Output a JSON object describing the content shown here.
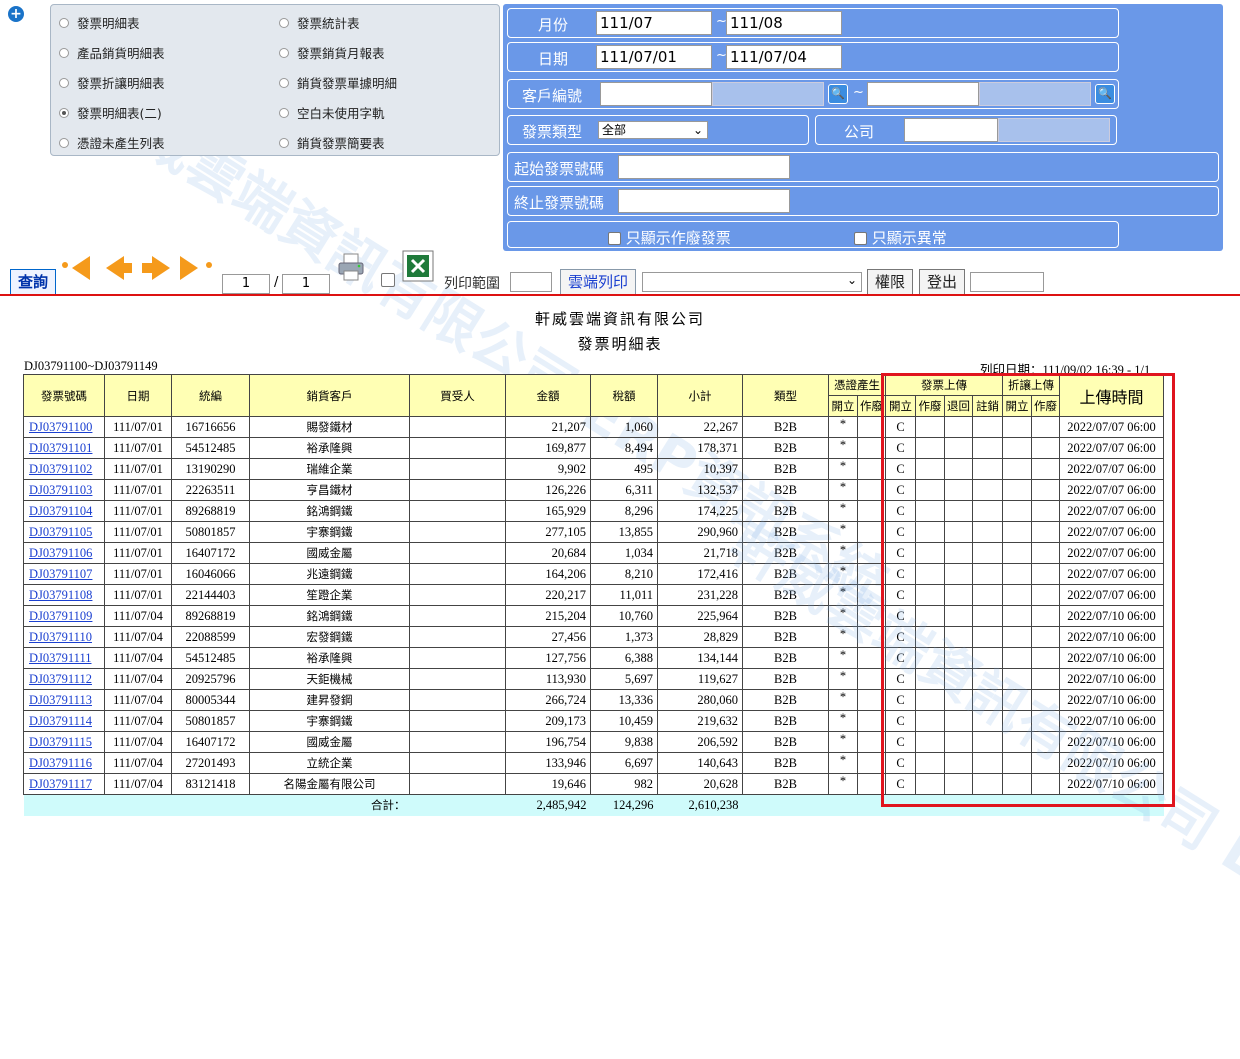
{
  "reports": {
    "left": [
      "發票明細表",
      "產品銷貨明細表",
      "發票折讓明細表",
      "發票明細表(二)",
      "憑證未產生列表"
    ],
    "right": [
      "發票統計表",
      "發票銷貨月報表",
      "銷貨發票單據明細",
      "空白未使用字軌",
      "銷貨發票簡要表"
    ],
    "selected": "發票明細表(二)"
  },
  "filters": {
    "month_label": "月份",
    "month_from": "111/07",
    "month_to": "111/08",
    "date_label": "日期",
    "date_from": "111/07/01",
    "date_to": "111/07/04",
    "customer_label": "客戶編號",
    "invoice_type_label": "發票類型",
    "invoice_type_value": "全部",
    "company_label": "公司",
    "start_no_label": "起始發票號碼",
    "end_no_label": "終止發票號碼",
    "only_void_label": "只顯示作廢發票",
    "only_abnormal_label": "只顯示異常",
    "tilde": "~"
  },
  "toolbar": {
    "query": "查詢",
    "page_current": "1",
    "page_sep": "/",
    "page_total": "1",
    "print_range": "列印範圍",
    "cloud_print": "雲端列印",
    "permission": "權限",
    "logout": "登出"
  },
  "report": {
    "company": "軒威雲端資訊有限公司",
    "name": "發票明細表",
    "range": "DJ03791100~DJ03791149",
    "print_date": "列印日期：111/09/02  16:39 - 1/1"
  },
  "watermark": "軒威雲端資訊有限公司 ERP資訊系統",
  "headers": {
    "no": "發票號碼",
    "date": "日期",
    "tax_id": "統編",
    "customer": "銷貨客戶",
    "buyer": "買受人",
    "amount": "金額",
    "tax": "稅額",
    "subtotal": "小計",
    "type": "類型",
    "voucher": "憑證產生",
    "upload": "發票上傳",
    "allowance": "折讓上傳",
    "upload_time": "上傳時間",
    "open": "開立",
    "void": "作廢",
    "return": "退回",
    "cancel": "註銷"
  },
  "rows": [
    {
      "no": "DJ03791100",
      "date": "111/07/01",
      "tax_id": "16716656",
      "customer": "賜發鐵材",
      "amount": "21,207",
      "tax": "1,060",
      "subtotal": "22,267",
      "type": "B2B",
      "v": "*",
      "u": "C",
      "time": "2022/07/07 06:00"
    },
    {
      "no": "DJ03791101",
      "date": "111/07/01",
      "tax_id": "54512485",
      "customer": "裕承隆興",
      "amount": "169,877",
      "tax": "8,494",
      "subtotal": "178,371",
      "type": "B2B",
      "v": "*",
      "u": "C",
      "time": "2022/07/07 06:00"
    },
    {
      "no": "DJ03791102",
      "date": "111/07/01",
      "tax_id": "13190290",
      "customer": "瑞維企業",
      "amount": "9,902",
      "tax": "495",
      "subtotal": "10,397",
      "type": "B2B",
      "v": "*",
      "u": "C",
      "time": "2022/07/07 06:00"
    },
    {
      "no": "DJ03791103",
      "date": "111/07/01",
      "tax_id": "22263511",
      "customer": "亨昌鐵材",
      "amount": "126,226",
      "tax": "6,311",
      "subtotal": "132,537",
      "type": "B2B",
      "v": "*",
      "u": "C",
      "time": "2022/07/07 06:00"
    },
    {
      "no": "DJ03791104",
      "date": "111/07/01",
      "tax_id": "89268819",
      "customer": "銘鴻鋼鐵",
      "amount": "165,929",
      "tax": "8,296",
      "subtotal": "174,225",
      "type": "B2B",
      "v": "*",
      "u": "C",
      "time": "2022/07/07 06:00"
    },
    {
      "no": "DJ03791105",
      "date": "111/07/01",
      "tax_id": "50801857",
      "customer": "宇寨鋼鐵",
      "amount": "277,105",
      "tax": "13,855",
      "subtotal": "290,960",
      "type": "B2B",
      "v": "*",
      "u": "C",
      "time": "2022/07/07 06:00"
    },
    {
      "no": "DJ03791106",
      "date": "111/07/01",
      "tax_id": "16407172",
      "customer": "國威金屬",
      "amount": "20,684",
      "tax": "1,034",
      "subtotal": "21,718",
      "type": "B2B",
      "v": "*",
      "u": "C",
      "time": "2022/07/07 06:00"
    },
    {
      "no": "DJ03791107",
      "date": "111/07/01",
      "tax_id": "16046066",
      "customer": "兆遠鋼鐵",
      "amount": "164,206",
      "tax": "8,210",
      "subtotal": "172,416",
      "type": "B2B",
      "v": "*",
      "u": "C",
      "time": "2022/07/07 06:00"
    },
    {
      "no": "DJ03791108",
      "date": "111/07/01",
      "tax_id": "22144403",
      "customer": "笙蹬企業",
      "amount": "220,217",
      "tax": "11,011",
      "subtotal": "231,228",
      "type": "B2B",
      "v": "*",
      "u": "C",
      "time": "2022/07/07 06:00"
    },
    {
      "no": "DJ03791109",
      "date": "111/07/04",
      "tax_id": "89268819",
      "customer": "銘鴻鋼鐵",
      "amount": "215,204",
      "tax": "10,760",
      "subtotal": "225,964",
      "type": "B2B",
      "v": "*",
      "u": "C",
      "time": "2022/07/10 06:00"
    },
    {
      "no": "DJ03791110",
      "date": "111/07/04",
      "tax_id": "22088599",
      "customer": "宏發鋼鐵",
      "amount": "27,456",
      "tax": "1,373",
      "subtotal": "28,829",
      "type": "B2B",
      "v": "*",
      "u": "C",
      "time": "2022/07/10 06:00"
    },
    {
      "no": "DJ03791111",
      "date": "111/07/04",
      "tax_id": "54512485",
      "customer": "裕承隆興",
      "amount": "127,756",
      "tax": "6,388",
      "subtotal": "134,144",
      "type": "B2B",
      "v": "*",
      "u": "C",
      "time": "2022/07/10 06:00"
    },
    {
      "no": "DJ03791112",
      "date": "111/07/04",
      "tax_id": "20925796",
      "customer": "天鉅機械",
      "amount": "113,930",
      "tax": "5,697",
      "subtotal": "119,627",
      "type": "B2B",
      "v": "*",
      "u": "C",
      "time": "2022/07/10 06:00"
    },
    {
      "no": "DJ03791113",
      "date": "111/07/04",
      "tax_id": "80005344",
      "customer": "建昇發鋼",
      "amount": "266,724",
      "tax": "13,336",
      "subtotal": "280,060",
      "type": "B2B",
      "v": "*",
      "u": "C",
      "time": "2022/07/10 06:00"
    },
    {
      "no": "DJ03791114",
      "date": "111/07/04",
      "tax_id": "50801857",
      "customer": "宇寨鋼鐵",
      "amount": "209,173",
      "tax": "10,459",
      "subtotal": "219,632",
      "type": "B2B",
      "v": "*",
      "u": "C",
      "time": "2022/07/10 06:00"
    },
    {
      "no": "DJ03791115",
      "date": "111/07/04",
      "tax_id": "16407172",
      "customer": "國威金屬",
      "amount": "196,754",
      "tax": "9,838",
      "subtotal": "206,592",
      "type": "B2B",
      "v": "*",
      "u": "C",
      "time": "2022/07/10 06:00"
    },
    {
      "no": "DJ03791116",
      "date": "111/07/04",
      "tax_id": "27201493",
      "customer": "立統企業",
      "amount": "133,946",
      "tax": "6,697",
      "subtotal": "140,643",
      "type": "B2B",
      "v": "*",
      "u": "C",
      "time": "2022/07/10 06:00"
    },
    {
      "no": "DJ03791117",
      "date": "111/07/04",
      "tax_id": "83121418",
      "customer": "名陽金屬有限公司",
      "amount": "19,646",
      "tax": "982",
      "subtotal": "20,628",
      "type": "B2B",
      "v": "*",
      "u": "C",
      "time": "2022/07/10 06:00"
    }
  ],
  "totals": {
    "label": "合計：",
    "amount": "2,485,942",
    "tax": "124,296",
    "subtotal": "2,610,238"
  },
  "colors": {
    "panel_blue": "#6a98e8",
    "header_yellow": "#ffffb4",
    "total_cyan": "#cffbfb",
    "highlight_red": "#e0141e",
    "arrow_orange": "#f59a1b"
  },
  "icons": [
    "plus-icon",
    "first-page-icon",
    "prev-page-icon",
    "next-page-icon",
    "last-page-icon",
    "printer-icon",
    "excel-icon",
    "search-icon"
  ]
}
